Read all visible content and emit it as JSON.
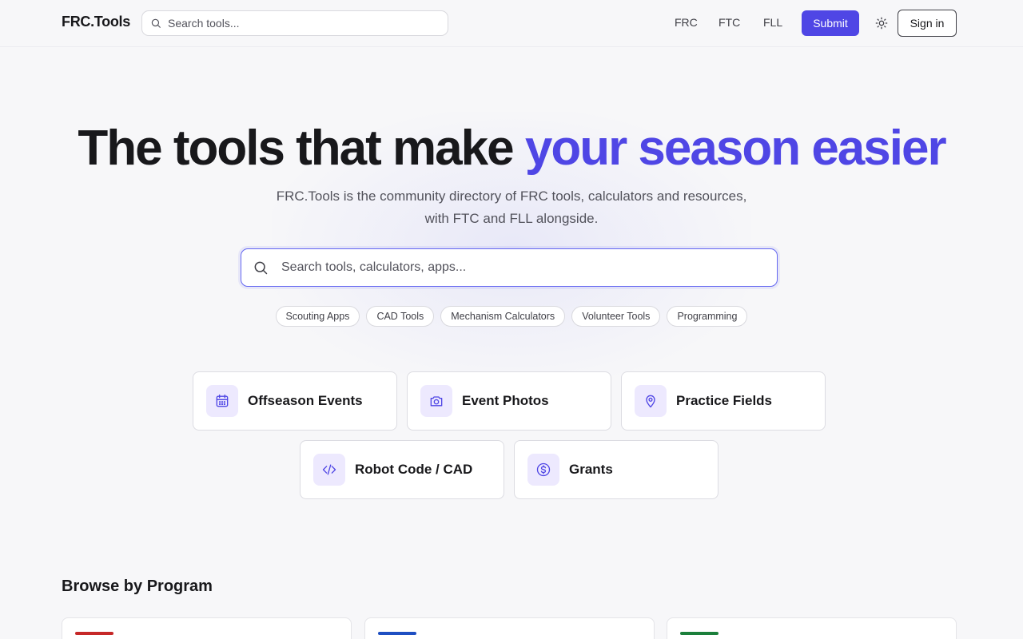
{
  "header": {
    "logo": "FRC.Tools",
    "search_placeholder": "Search tools...",
    "nav": [
      "FRC",
      "FTC",
      "FLL"
    ],
    "submit_label": "Submit",
    "signin_label": "Sign in",
    "theme_icon": "sun-icon"
  },
  "hero": {
    "title_plain": "The tools that make ",
    "title_accent": "your season easier",
    "subtitle": "FRC.Tools is the community directory of FRC tools, calculators and resources, with FTC and FLL alongside.",
    "search_placeholder": "Search tools, calculators, apps...",
    "chips": [
      "Scouting Apps",
      "CAD Tools",
      "Mechanism Calculators",
      "Volunteer Tools",
      "Programming"
    ]
  },
  "features": [
    {
      "label": "Offseason Events",
      "icon": "calendar-icon"
    },
    {
      "label": "Event Photos",
      "icon": "camera-icon"
    },
    {
      "label": "Practice Fields",
      "icon": "map-pin-icon"
    },
    {
      "label": "Robot Code / CAD",
      "icon": "code-icon"
    },
    {
      "label": "Grants",
      "icon": "dollar-circle-icon"
    }
  ],
  "browse": {
    "title": "Browse by Program",
    "program_colors": [
      "#c62828",
      "#1e4fc2",
      "#1b7f3b"
    ]
  },
  "colors": {
    "accent": "#4f46e5",
    "icon_bg": "#ede9fe"
  }
}
